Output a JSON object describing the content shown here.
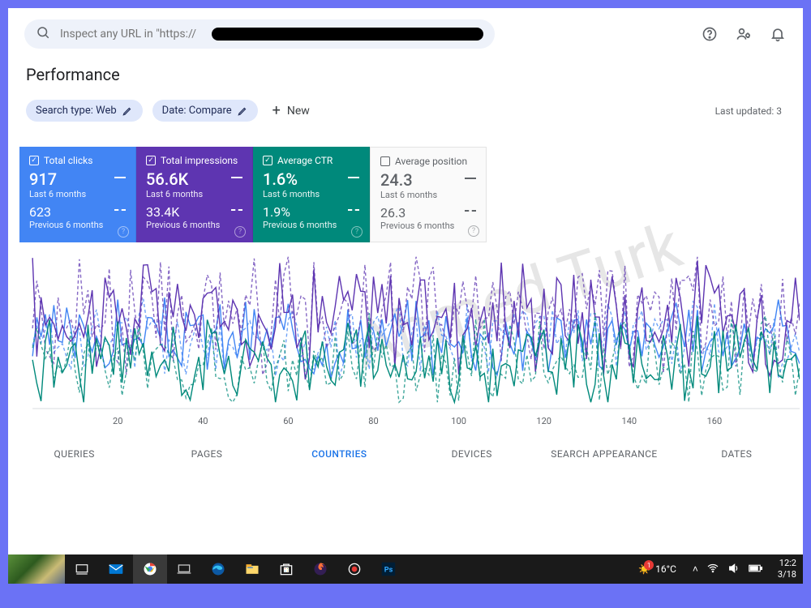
{
  "search": {
    "placeholder": "Inspect any URL in \"https://"
  },
  "page_title": "Performance",
  "filters": {
    "search_type": "Search type: Web",
    "date": "Date: Compare",
    "new": "New"
  },
  "last_updated": "Last updated: 3",
  "cards": [
    {
      "checked": true,
      "name": "Total clicks",
      "val": "917",
      "period": "Last 6 months",
      "prev_val": "623",
      "prev_period": "Previous 6 months",
      "color": "blue"
    },
    {
      "checked": true,
      "name": "Total impressions",
      "val": "56.6K",
      "period": "Last 6 months",
      "prev_val": "33.4K",
      "prev_period": "Previous 6 months",
      "color": "purple"
    },
    {
      "checked": true,
      "name": "Average CTR",
      "val": "1.6%",
      "period": "Last 6 months",
      "prev_val": "1.9%",
      "prev_period": "Previous 6 months",
      "color": "teal"
    },
    {
      "checked": false,
      "name": "Average position",
      "val": "24.3",
      "period": "Last 6 months",
      "prev_val": "26.3",
      "prev_period": "Previous 6 months",
      "color": "grey"
    }
  ],
  "chart_data": {
    "type": "line",
    "xlabel": "",
    "ylabel": "",
    "x_ticks": [
      20,
      40,
      60,
      80,
      100,
      120,
      140,
      160
    ],
    "xlim": [
      0,
      180
    ],
    "ylim": [
      0,
      100
    ],
    "series": [
      {
        "name": "Clicks (last 6 months)",
        "color": "#4285f4",
        "dashed": false
      },
      {
        "name": "Clicks (previous 6 months)",
        "color": "#4285f4",
        "dashed": true
      },
      {
        "name": "Impressions (last 6 months)",
        "color": "#5e35b1",
        "dashed": false
      },
      {
        "name": "Impressions (previous 6 months)",
        "color": "#5e35b1",
        "dashed": true
      },
      {
        "name": "CTR (last 6 months)",
        "color": "#00897b",
        "dashed": false
      },
      {
        "name": "CTR (previous 6 months)",
        "color": "#00897b",
        "dashed": true
      }
    ],
    "note": "Dense daily series over ~180 days; individual point values are not legible in the screenshot and are approximated procedurally in the rendered chart."
  },
  "tabs": [
    "QUERIES",
    "PAGES",
    "COUNTRIES",
    "DEVICES",
    "SEARCH APPEARANCE",
    "DATES"
  ],
  "active_tab": "COUNTRIES",
  "taskbar": {
    "weather_temp": "16°C",
    "time": "12:2",
    "date": "3/18"
  },
  "watermark": "Ahmed Turk"
}
